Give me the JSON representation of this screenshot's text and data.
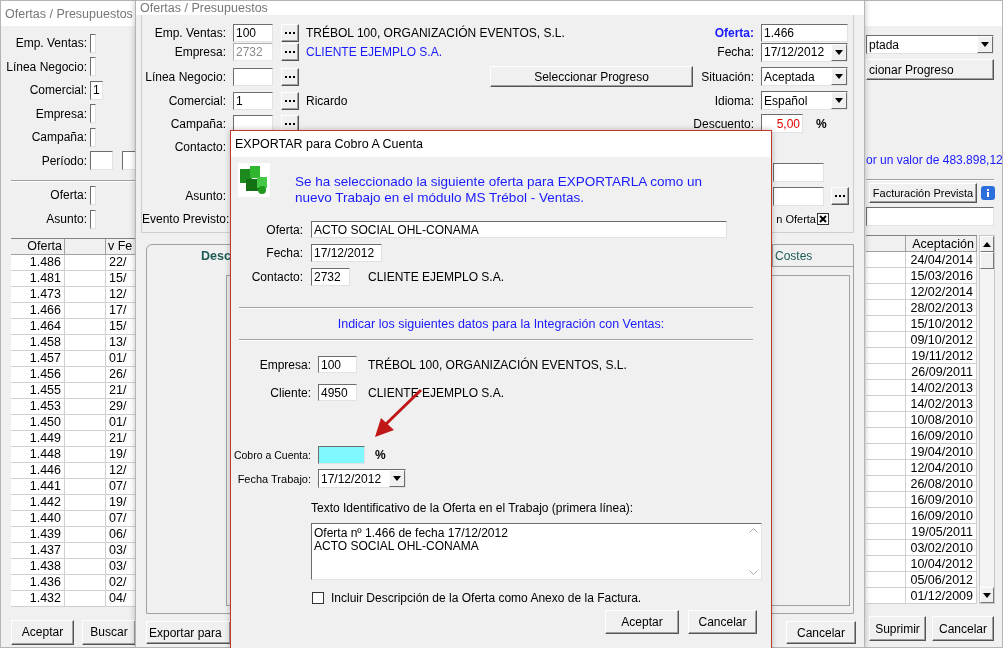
{
  "back_window": {
    "title": "Ofertas / Presupuestos",
    "filters": [
      {
        "label": "Emp. Ventas:"
      },
      {
        "label": "Línea Negocio:"
      },
      {
        "label": "Comercial:",
        "value": "1"
      },
      {
        "label": "Empresa:"
      },
      {
        "label": "Campaña:"
      }
    ],
    "period": {
      "label": "Período:"
    },
    "search_fields": [
      {
        "label": "Oferta:"
      },
      {
        "label": "Asunto:"
      }
    ],
    "status_value": "ptada",
    "progress_button": "cionar Progreso",
    "total_text": "or un valor de 483.898,12",
    "billing_button": "Facturación Prevista",
    "table": {
      "columns": [
        "Oferta",
        "v Fe",
        "Aceptación"
      ],
      "rows": [
        {
          "offer": "1.486",
          "date": "22/",
          "accepted": "24/04/2014"
        },
        {
          "offer": "1.481",
          "date": "15/",
          "accepted": "15/03/2016"
        },
        {
          "offer": "1.473",
          "date": "12/",
          "accepted": "12/02/2014"
        },
        {
          "offer": "1.466",
          "date": "17/",
          "accepted": "28/02/2013"
        },
        {
          "offer": "1.464",
          "date": "15/",
          "accepted": "15/10/2012"
        },
        {
          "offer": "1.458",
          "date": "13/",
          "accepted": "09/10/2012"
        },
        {
          "offer": "1.457",
          "date": "01/",
          "accepted": "19/11/2012"
        },
        {
          "offer": "1.456",
          "date": "26/",
          "accepted": "26/09/2011"
        },
        {
          "offer": "1.455",
          "date": "21/",
          "accepted": "14/02/2013"
        },
        {
          "offer": "1.453",
          "date": "29/",
          "accepted": "14/02/2013"
        },
        {
          "offer": "1.450",
          "date": "01/",
          "accepted": "10/08/2010"
        },
        {
          "offer": "1.449",
          "date": "21/",
          "accepted": "16/09/2010"
        },
        {
          "offer": "1.448",
          "date": "19/",
          "accepted": "19/04/2010"
        },
        {
          "offer": "1.446",
          "date": "12/",
          "accepted": "12/04/2010"
        },
        {
          "offer": "1.441",
          "date": "07/",
          "accepted": "26/08/2010"
        },
        {
          "offer": "1.442",
          "date": "19/",
          "accepted": "16/09/2010"
        },
        {
          "offer": "1.440",
          "date": "07/",
          "accepted": "16/09/2010"
        },
        {
          "offer": "1.439",
          "date": "06/",
          "accepted": "19/05/2011"
        },
        {
          "offer": "1.437",
          "date": "03/",
          "accepted": "03/02/2010"
        },
        {
          "offer": "1.438",
          "date": "03/",
          "accepted": "10/04/2012"
        },
        {
          "offer": "1.436",
          "date": "02/",
          "accepted": "05/06/2012"
        },
        {
          "offer": "1.432",
          "date": "04/",
          "accepted": "01/12/2009"
        }
      ]
    },
    "buttons_left": [
      "Aceptar",
      "Buscar"
    ],
    "buttons_right": [
      "Suprimir",
      "Cancelar"
    ]
  },
  "offer_window": {
    "title": "Ofertas / Presupuestos",
    "form_rows": [
      {
        "left": {
          "kind": "lookup",
          "label": "Emp. Ventas:",
          "value": "100",
          "disabled": false,
          "description": "TRÉBOL 100, ORGANIZACIÓN EVENTOS, S.L.",
          "link": false
        },
        "right": {
          "kind": "field",
          "label": "Oferta:",
          "value": "1.466",
          "highlight": true
        }
      },
      {
        "left": {
          "kind": "lookup",
          "label": "Empresa:",
          "value": "2732",
          "disabled": true,
          "description": "CLIENTE EJEMPLO S.A.",
          "link": true
        },
        "right": {
          "kind": "dropdown",
          "label": "Fecha:",
          "value": "17/12/2012",
          "highlight": false
        }
      },
      {
        "left": {
          "kind": "lookup",
          "label": "Línea Negocio:",
          "disabled": false,
          "button": "Seleccionar Progreso"
        },
        "right": {
          "kind": "dropdown",
          "label": "Situación:",
          "value": "Aceptada",
          "highlight": false
        }
      },
      {
        "left": {
          "kind": "lookup",
          "label": "Comercial:",
          "value": "1",
          "disabled": false,
          "description": "Ricardo",
          "link": false
        },
        "right": {
          "kind": "dropdown",
          "label": "Idioma:",
          "value": "Español",
          "highlight": false
        }
      },
      {
        "left": {
          "kind": "lookup",
          "label": "Campaña:",
          "disabled": false
        },
        "right": {
          "kind": "percent",
          "label": "Descuento:",
          "value": "5,00",
          "unit": "%",
          "highlight": false
        }
      },
      {
        "left": {
          "kind": "label",
          "label": "Contacto:"
        }
      },
      {
        "right": {
          "kind": "plain_field"
        }
      },
      {
        "left": {
          "kind": "label",
          "label": "Asunto:"
        },
        "right": {
          "kind": "lookup_field"
        }
      },
      {
        "left": {
          "kind": "label",
          "label": "Evento Previsto:"
        },
        "right": {
          "kind": "checkbox",
          "label": "n Oferta",
          "checked": true
        }
      }
    ],
    "tabs": [
      {
        "label": "Desc",
        "selected": true
      },
      {
        "label": "Costes",
        "selected": false
      }
    ],
    "buttons": [
      "Exportar para",
      "Cancelar"
    ]
  },
  "export_dialog": {
    "title": "EXPORTAR para Cobro A Cuenta",
    "message": "Se ha seleccionado la siguiente oferta para EXPORTARLA como un nuevo Trabajo en el módulo MS Trébol - Ventas.",
    "offer_fields": [
      {
        "label": "Oferta:",
        "value": "ACTO SOCIAL OHL-CONAMA"
      },
      {
        "label": "Fecha:",
        "value": "17/12/2012"
      },
      {
        "label": "Contacto:",
        "value": "2732",
        "description": "CLIENTE EJEMPLO S.A."
      }
    ],
    "section_heading": "Indicar los siguientes datos para la Integración con Ventas:",
    "integration_fields": [
      {
        "label": "Empresa:",
        "value": "100",
        "description": "TRÉBOL 100, ORGANIZACIÓN EVENTOS, S.L."
      },
      {
        "label": "Cliente:",
        "value": "4950",
        "description": "CLIENTE EJEMPLO S.A."
      }
    ],
    "advance": {
      "label": "Cobro a Cuenta:",
      "unit": "%",
      "focused": true
    },
    "work_date": {
      "label": "Fecha Trabajo:",
      "value": "17/12/2012"
    },
    "text_label": "Texto Identificativo de la Oferta en el Trabajo (primera línea):",
    "text_value": "Oferta nº 1.466 de fecha 17/12/2012\nACTO SOCIAL OHL-CONAMA",
    "attach_checkbox": {
      "label": "Incluir Descripción de la Oferta como Anexo de la Factura.",
      "checked": false
    },
    "buttons": [
      "Aceptar",
      "Cancelar"
    ]
  }
}
